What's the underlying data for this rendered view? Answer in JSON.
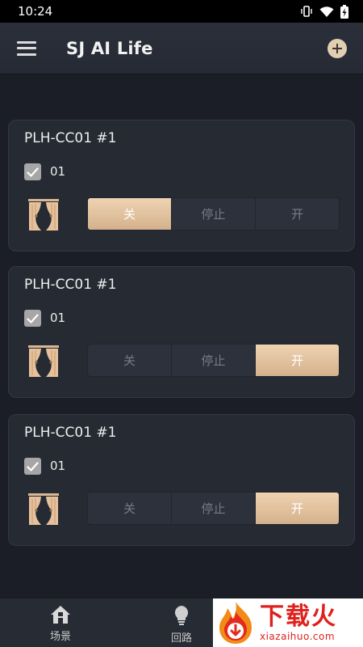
{
  "status_bar": {
    "time": "10:24"
  },
  "app_bar": {
    "title": "SJ AI Life"
  },
  "cards": [
    {
      "title": "PLH-CC01 #1",
      "channel": "01",
      "checked": true,
      "buttons": [
        "关",
        "停止",
        "开"
      ],
      "active": 0
    },
    {
      "title": "PLH-CC01 #1",
      "channel": "01",
      "checked": true,
      "buttons": [
        "关",
        "停止",
        "开"
      ],
      "active": 2
    },
    {
      "title": "PLH-CC01 #1",
      "channel": "01",
      "checked": true,
      "buttons": [
        "关",
        "停止",
        "开"
      ],
      "active": 2
    }
  ],
  "bottom_nav": {
    "items": [
      {
        "label": "场景",
        "icon": "home-icon"
      },
      {
        "label": "回路",
        "icon": "bulb-icon"
      }
    ]
  },
  "watermark": {
    "text": "下载火",
    "url": "xiazaihuo.com"
  },
  "colors": {
    "accent": "#e3c29e",
    "background": "#1b1e26",
    "card": "#262a33"
  }
}
